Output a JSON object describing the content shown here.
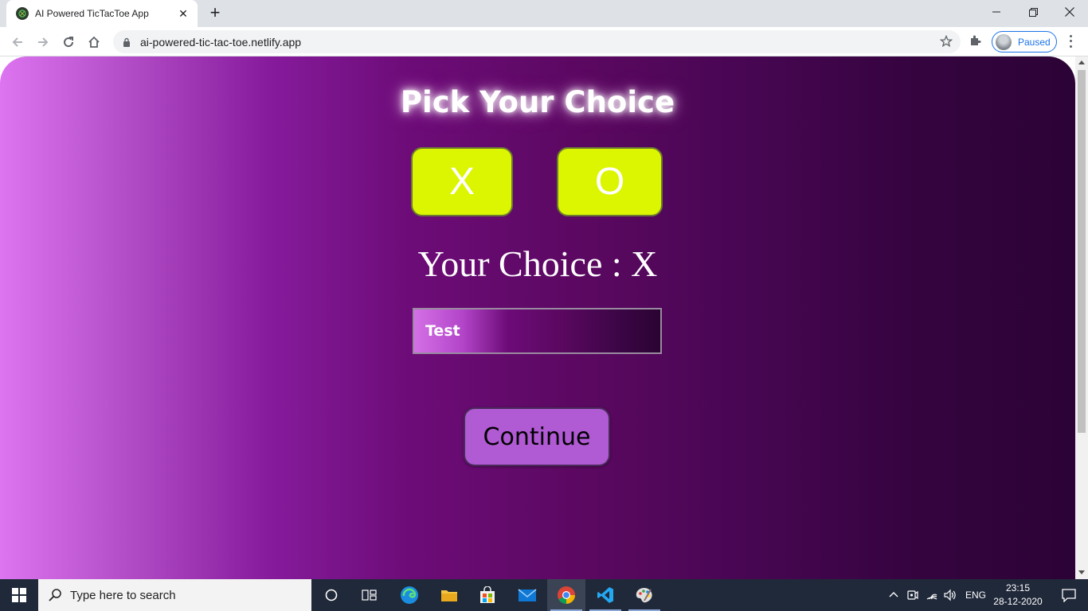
{
  "browser": {
    "tab_title": "AI Powered TicTacToe App",
    "url": "ai-powered-tic-tac-toe.netlify.app",
    "profile_label": "Paused"
  },
  "page": {
    "heading": "Pick Your Choice",
    "choice_x": "X",
    "choice_o": "O",
    "your_choice": "Your Choice : X",
    "name_value": "Test",
    "continue_label": "Continue"
  },
  "taskbar": {
    "search_placeholder": "Type here to search",
    "language": "ENG",
    "time": "23:15",
    "date": "28-12-2020"
  },
  "colors": {
    "choice_button": "#dcf500",
    "continue_button": "#b05ad4",
    "gradient_left": "#dd74f0",
    "gradient_right": "#2c0336"
  }
}
